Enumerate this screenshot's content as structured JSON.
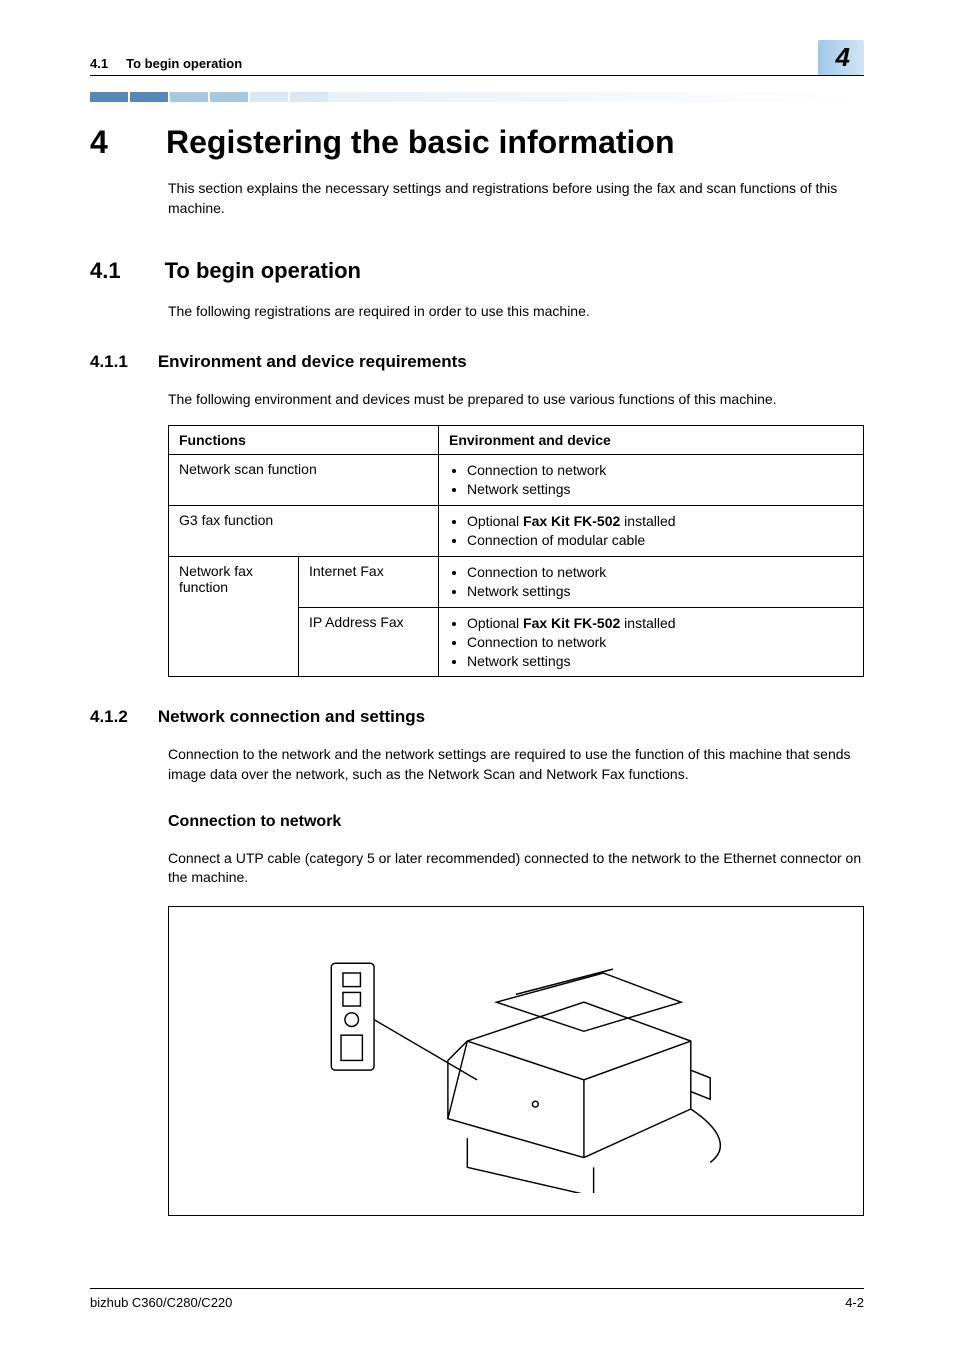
{
  "header": {
    "section_number": "4.1",
    "section_title": "To begin operation",
    "chapter_badge": "4"
  },
  "chapter": {
    "number": "4",
    "title": "Registering the basic information",
    "intro": "This section explains the necessary settings and registrations before using the fax and scan functions of this machine."
  },
  "section_4_1": {
    "number": "4.1",
    "title": "To begin operation",
    "intro": "The following registrations are required in order to use this machine."
  },
  "section_4_1_1": {
    "number": "4.1.1",
    "title": "Environment and device requirements",
    "intro": "The following environment and devices must be prepared to use various functions of this machine.",
    "table": {
      "head_functions": "Functions",
      "head_env": "Environment and device",
      "rows": [
        {
          "func": "Network scan function",
          "sub": "",
          "env": [
            "Connection to network",
            "Network settings"
          ]
        },
        {
          "func": "G3 fax function",
          "sub": "",
          "env_html": [
            {
              "prefix": "Optional ",
              "bold": "Fax Kit FK-502",
              "suffix": " installed"
            },
            {
              "text": "Connection of modular cable"
            }
          ]
        },
        {
          "func": "Network fax function",
          "sub": "Internet Fax",
          "env": [
            "Connection to network",
            "Network settings"
          ]
        },
        {
          "func": "",
          "sub": "IP Address Fax",
          "env_html": [
            {
              "prefix": "Optional ",
              "bold": "Fax Kit FK-502",
              "suffix": " installed"
            },
            {
              "text": "Connection to network"
            },
            {
              "text": "Network settings"
            }
          ]
        }
      ]
    }
  },
  "section_4_1_2": {
    "number": "4.1.2",
    "title": "Network connection and settings",
    "intro": "Connection to the network and the network settings are required to use the function of this machine that sends image data over the network, such as the Network Scan and Network Fax functions.",
    "subhead": "Connection to network",
    "subpara": "Connect a UTP cable (category 5 or later recommended) connected to the network to the Ethernet connector on the machine."
  },
  "footer": {
    "model": "bizhub C360/C280/C220",
    "page": "4-2"
  }
}
